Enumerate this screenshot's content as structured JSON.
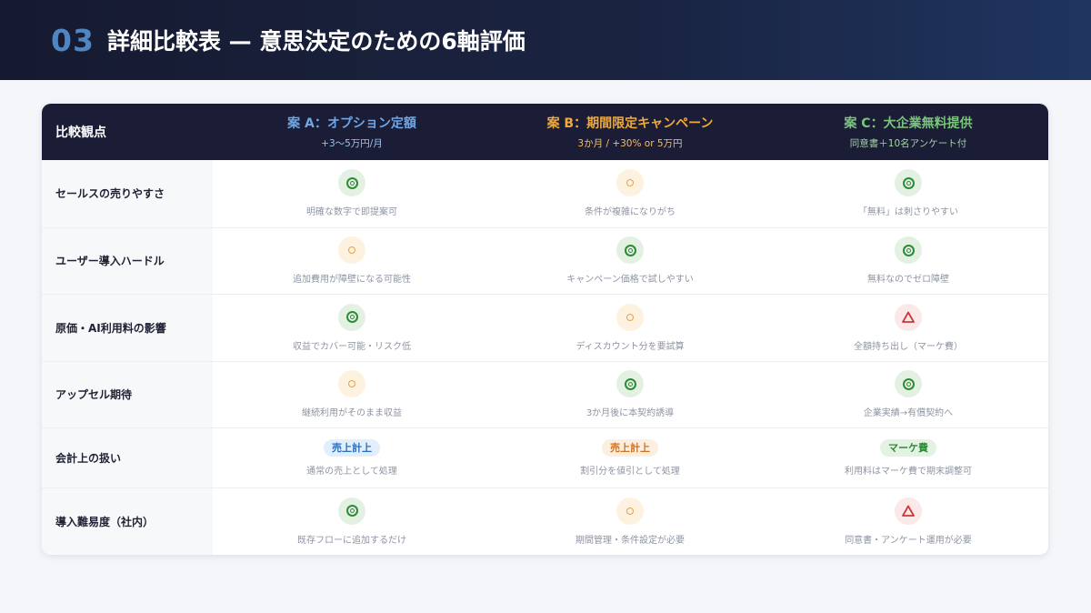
{
  "header": {
    "number": "03",
    "title": "詳細比較表 — 意思決定のための6軸評価"
  },
  "table": {
    "corner_label": "比較観点",
    "options": [
      {
        "name": "案 A：オプション定額",
        "sub": "+3〜5万円/月",
        "color": "#6ea6e6"
      },
      {
        "name": "案 B：期間限定キャンペーン",
        "sub": "3か月 / +30% or 5万円",
        "color": "#f0a93a"
      },
      {
        "name": "案 C：大企業無料提供",
        "sub": "同意書＋10名アンケート付",
        "color": "#7cc47e"
      }
    ],
    "rows": [
      {
        "label": "セールスの売りやすさ",
        "cells": [
          {
            "rating": "double-circle-icon",
            "note": "明確な数字で即提案可"
          },
          {
            "rating": "circle-icon",
            "note": "条件が複雑になりがち"
          },
          {
            "rating": "double-circle-icon",
            "note": "「無料」は刺さりやすい"
          }
        ]
      },
      {
        "label": "ユーザー導入ハードル",
        "cells": [
          {
            "rating": "circle-icon",
            "note": "追加費用が障壁になる可能性"
          },
          {
            "rating": "double-circle-icon",
            "note": "キャンペーン価格で試しやすい"
          },
          {
            "rating": "double-circle-icon",
            "note": "無料なのでゼロ障壁"
          }
        ]
      },
      {
        "label": "原価・AI利用料の影響",
        "cells": [
          {
            "rating": "double-circle-icon",
            "note": "収益でカバー可能・リスク低"
          },
          {
            "rating": "circle-icon",
            "note": "ディスカウント分を要試算"
          },
          {
            "rating": "triangle-icon",
            "note": "全額持ち出し（マーケ費）"
          }
        ]
      },
      {
        "label": "アップセル期待",
        "cells": [
          {
            "rating": "circle-icon",
            "note": "継続利用がそのまま収益"
          },
          {
            "rating": "double-circle-icon",
            "note": "3か月後に本契約誘導"
          },
          {
            "rating": "double-circle-icon",
            "note": "企業実績→有償契約へ"
          }
        ]
      },
      {
        "label": "会計上の扱い",
        "cells": [
          {
            "badge": "売上計上",
            "badge_color": "#2a6fc2",
            "note": "通常の売上として処理"
          },
          {
            "badge": "売上計上",
            "badge_color": "#d1731e",
            "note": "割引分を値引として処理"
          },
          {
            "badge": "マーケ費",
            "badge_color": "#2f8a36",
            "note": "利用料はマーケ費で期末調整可"
          }
        ]
      },
      {
        "label": "導入難易度（社内）",
        "cells": [
          {
            "rating": "double-circle-icon",
            "note": "既存フローに追加するだけ"
          },
          {
            "rating": "circle-icon",
            "note": "期間管理・条件設定が必要"
          },
          {
            "rating": "triangle-icon",
            "note": "同意書・アンケート運用が必要"
          }
        ]
      }
    ]
  }
}
